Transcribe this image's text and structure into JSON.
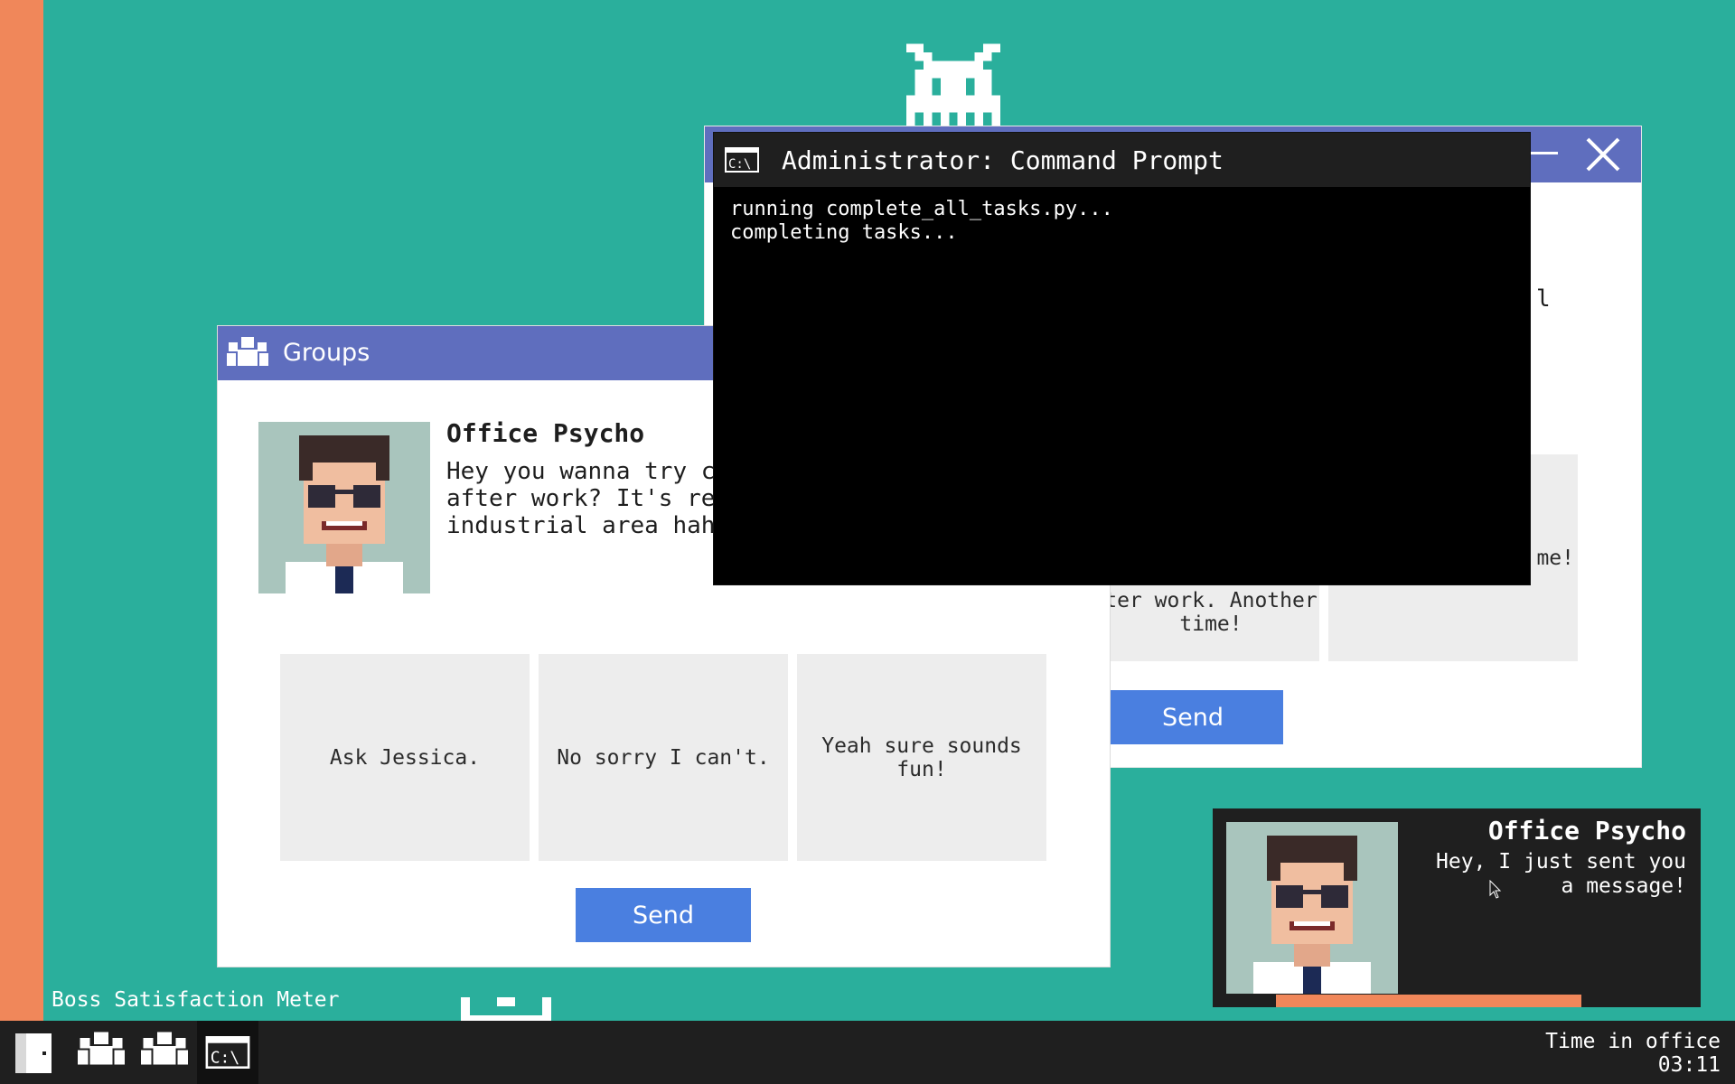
{
  "boss_meter": {
    "label": "Boss Satisfaction Meter"
  },
  "icons": {
    "invader": "space-invader-icon",
    "groups": "group-icon",
    "cmd": "command-prompt-icon",
    "minimize": "minimize-icon",
    "close": "close-icon",
    "start": "door-icon",
    "cursor": "mouse-cursor-icon"
  },
  "back_window": {
    "choices": [
      {
        "label": "ter work. Another time!"
      },
      {
        "label": "me!"
      }
    ],
    "send_label": "Send",
    "partial_text": "l"
  },
  "groups_window": {
    "title": "Groups",
    "sender": "Office Psycho",
    "message": "Hey you wanna try c\nafter work? It's real\nindustrial area haha",
    "choices": [
      {
        "label": "Ask Jessica."
      },
      {
        "label": "No sorry I can't."
      },
      {
        "label": "Yeah sure sounds fun!"
      }
    ],
    "send_label": "Send"
  },
  "cmd_window": {
    "title": "Administrator: Command Prompt",
    "lines": [
      "running complete_all_tasks.py...",
      "completing tasks..."
    ]
  },
  "notification": {
    "sender": "Office Psycho",
    "text": "Hey, I just sent you a message!",
    "progress": 0.72
  },
  "taskbar": {
    "clock_label": "Time in office",
    "clock_value": "03:11"
  },
  "colors": {
    "desktop": "#2aaf9c",
    "meter": "#f0875a",
    "titlebar": "#5f6ebe",
    "send": "#4a7fe0",
    "taskbar": "#1f1f1f"
  }
}
